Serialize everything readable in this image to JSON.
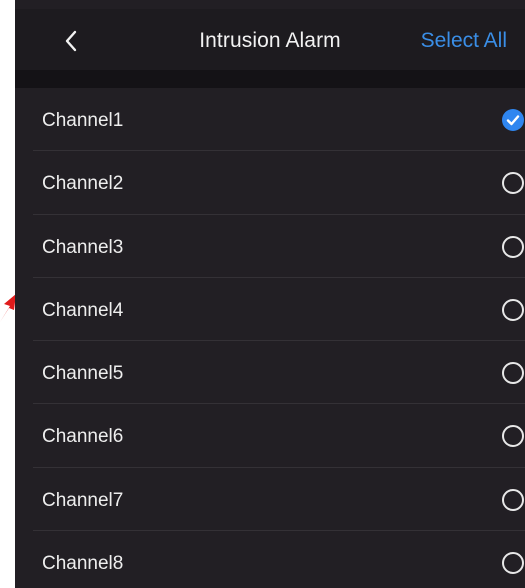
{
  "header": {
    "title": "Intrusion Alarm",
    "action_label": "Select All",
    "back_icon": "chevron-left-icon"
  },
  "channels": [
    {
      "label": "Channel1",
      "selected": true
    },
    {
      "label": "Channel2",
      "selected": false
    },
    {
      "label": "Channel3",
      "selected": false
    },
    {
      "label": "Channel4",
      "selected": false
    },
    {
      "label": "Channel5",
      "selected": false
    },
    {
      "label": "Channel6",
      "selected": false
    },
    {
      "label": "Channel7",
      "selected": false
    },
    {
      "label": "Channel8",
      "selected": false
    }
  ],
  "colors": {
    "accent": "#3a8ee6",
    "check_fill": "#2f86f0",
    "background": "#221f24",
    "annotation": "#e01b1b"
  }
}
